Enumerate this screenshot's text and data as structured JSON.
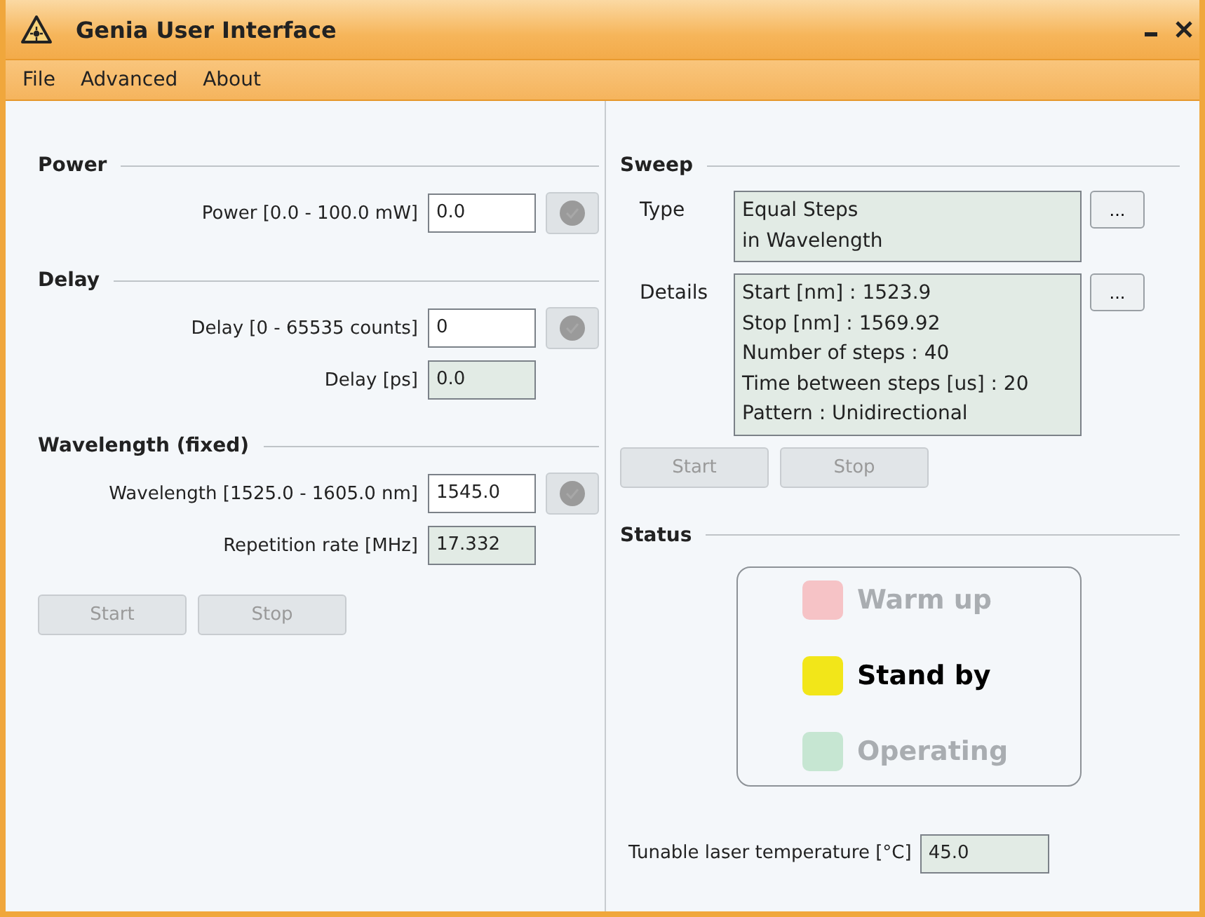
{
  "window": {
    "title": "Genia User Interface"
  },
  "menu": [
    "File",
    "Advanced",
    "About"
  ],
  "left_sections": [
    {
      "heading": "Power",
      "rows": [
        {
          "label": "Power [0.0 - 100.0 mW]",
          "value": "0.0",
          "kind": "input",
          "apply": true
        }
      ]
    },
    {
      "heading": "Delay",
      "rows": [
        {
          "label": "Delay [0 - 65535 counts]",
          "value": "0",
          "kind": "input",
          "apply": true
        },
        {
          "label": "Delay [ps]",
          "value": "0.0",
          "kind": "readout",
          "apply": false
        }
      ]
    },
    {
      "heading": "Wavelength (fixed)",
      "rows": [
        {
          "label": "Wavelength [1525.0 - 1605.0 nm]",
          "value": "1545.0",
          "kind": "input",
          "apply": true
        },
        {
          "label": "Repetition rate [MHz]",
          "value": "17.332",
          "kind": "readout",
          "apply": false
        }
      ]
    }
  ],
  "left_buttons": [
    {
      "label": "Start",
      "disabled": true
    },
    {
      "label": "Stop",
      "disabled": true
    }
  ],
  "sweep": {
    "heading": "Sweep",
    "rows": [
      {
        "label": "Type",
        "lines": [
          "Equal Steps",
          "in Wavelength"
        ],
        "button": "..."
      },
      {
        "label": "Details",
        "lines": [
          "Start [nm] : 1523.9",
          "Stop [nm] : 1569.92",
          "Number of steps : 40",
          "Time between steps [us] : 20",
          "Pattern : Unidirectional"
        ],
        "button": "..."
      }
    ],
    "buttons": [
      {
        "label": "Start",
        "disabled": true
      },
      {
        "label": "Stop",
        "disabled": true
      }
    ]
  },
  "status": {
    "heading": "Status",
    "items": [
      {
        "label": "Warm up",
        "color": "#f6c3c6",
        "active": false
      },
      {
        "label": "Stand by",
        "color": "#f2e619",
        "active": true
      },
      {
        "label": "Operating",
        "color": "#c6e6d2",
        "active": false
      }
    ]
  },
  "temperature": {
    "label": "Tunable laser temperature [°C]",
    "value": "45.0"
  }
}
